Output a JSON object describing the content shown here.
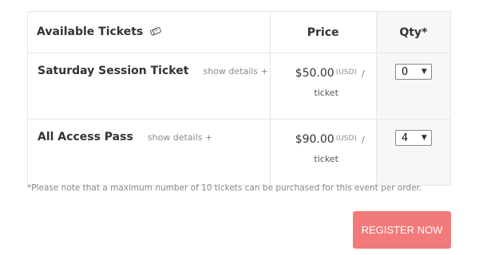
{
  "table": {
    "header_tickets": "Available Tickets",
    "header_price": "Price",
    "header_qty": "Qty*",
    "tickets_icon": "tickets-icon"
  },
  "tickets": [
    {
      "name": "Saturday Session Ticket",
      "details_link": "show details +",
      "price": "$50.00",
      "currency": "(USD)",
      "slash": "/",
      "per": "ticket",
      "qty": "0"
    },
    {
      "name": "All Access Pass",
      "details_link": "show details +",
      "price": "$90.00",
      "currency": "(USD)",
      "slash": "/",
      "per": "ticket",
      "qty": "4"
    }
  ],
  "note": "*Please note that a maximum number of 10 tickets can be purchased for this event per order.",
  "register_label": "REGISTER NOW",
  "colors": {
    "register_bg": "#f27a7b",
    "qty_bg": "#f7f7f7"
  }
}
